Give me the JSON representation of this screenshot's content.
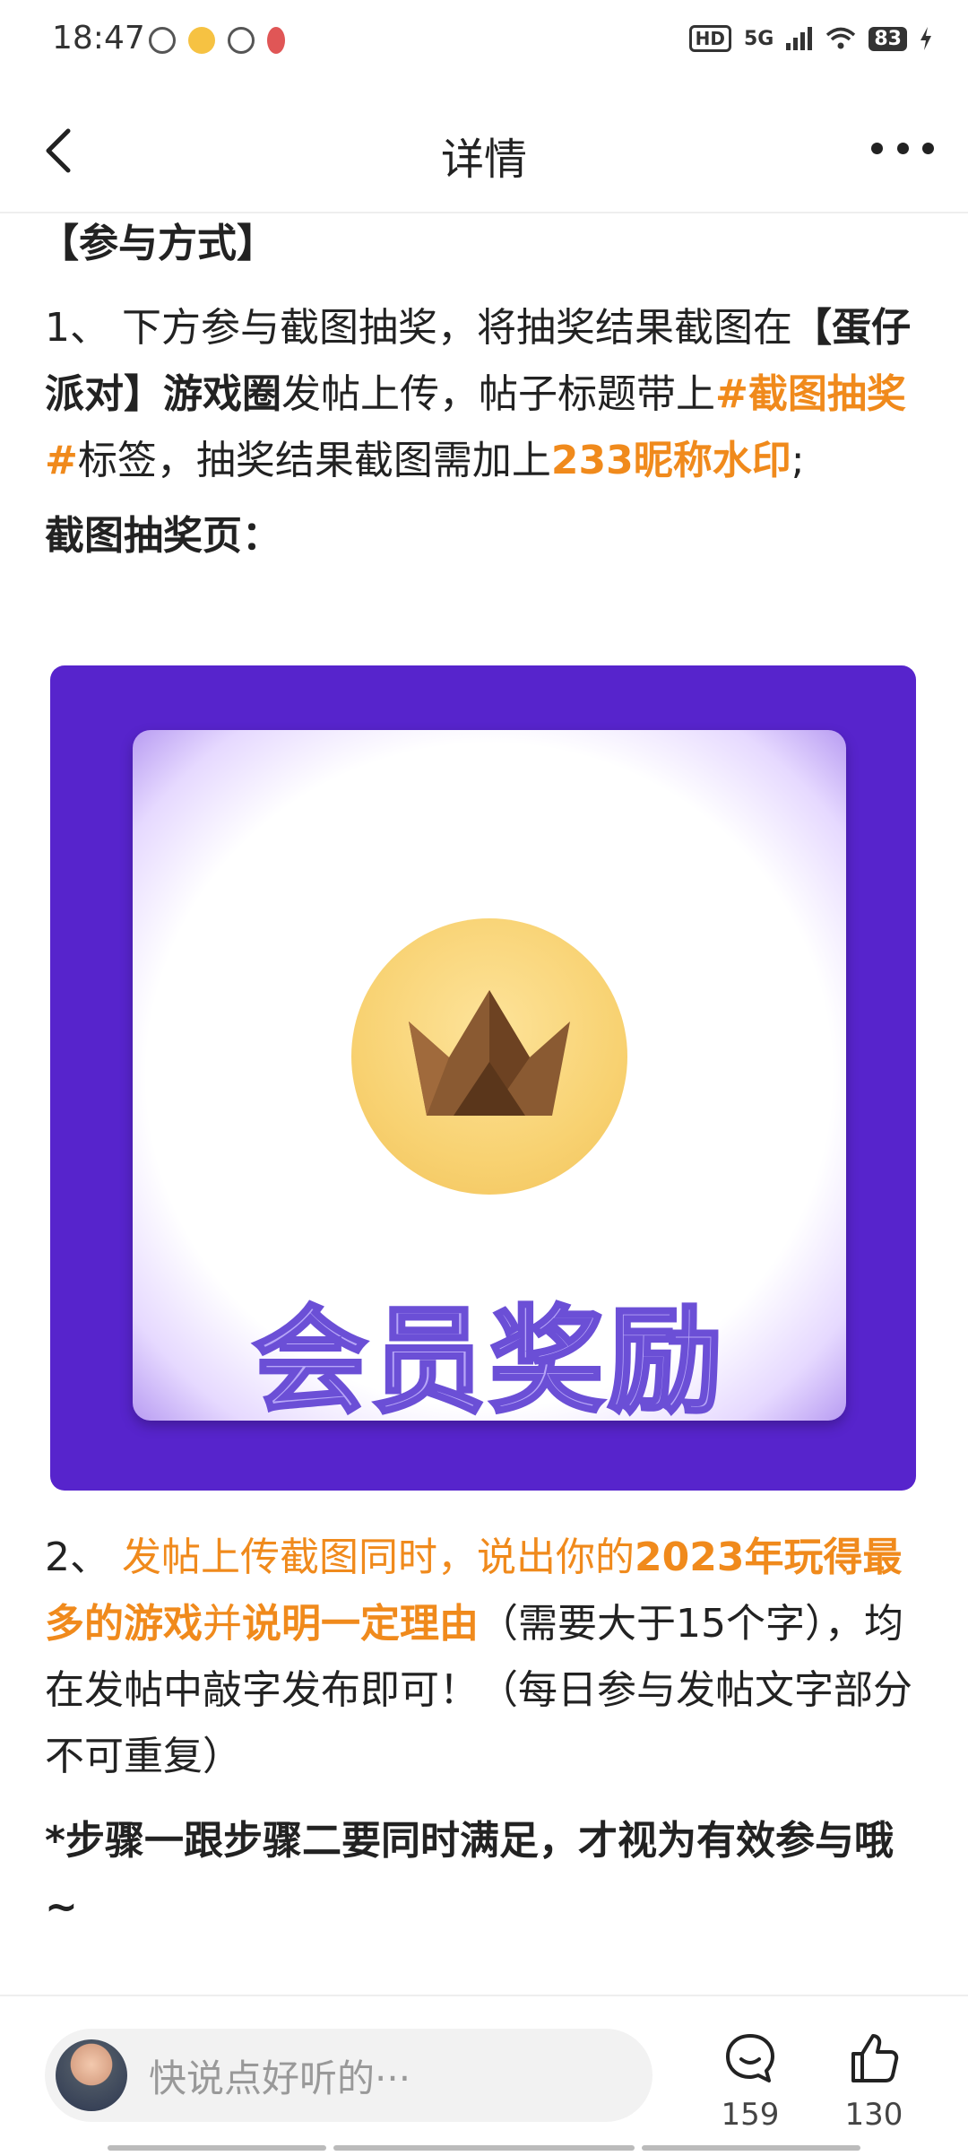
{
  "status_bar": {
    "time": "18:47",
    "network": "5G",
    "hd": "HD",
    "battery": "83"
  },
  "header": {
    "title": "详情"
  },
  "content": {
    "section_title": "【参与方式】",
    "step1": {
      "prefix": "1、 下方参与截图抽奖，将抽奖结果截图在",
      "game_circle": "【蛋仔派对】游戏圈",
      "mid": "发帖上传，帖子标题带上",
      "tag": "#截图抽奖#",
      "mid2": "标签，抽奖结果截图需加上",
      "watermark": "233昵称水印",
      "suffix": ";"
    },
    "lottery_label": "截图抽奖页：",
    "promo_banner_text": "会员奖励",
    "step2": {
      "prefix": "2、 ",
      "orange1": "发帖上传截图同时，说出你的",
      "bold1": "2023年玩得最多的游戏",
      "orange2": "并",
      "bold2": "说明一定理由",
      "suffix": "（需要大于15个字），均在发帖中敲字发布即可！（每日参与发帖文字部分不可重复）"
    },
    "note": "*步骤一跟步骤二要同时满足，才视为有效参与哦~"
  },
  "bottom_bar": {
    "comment_placeholder": "快说点好听的···",
    "comment_count": "159",
    "like_count": "130"
  },
  "colors": {
    "accent_orange": "#f08a1c",
    "banner_purple": "#5724cc"
  }
}
